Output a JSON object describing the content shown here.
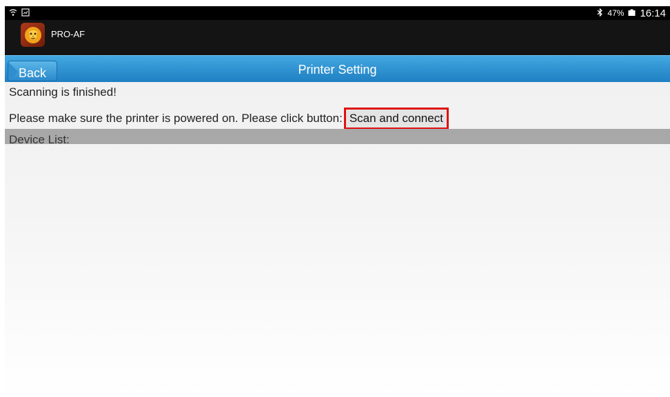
{
  "status_bar": {
    "left_icons": [
      "wifi-icon",
      "screenshot-icon"
    ],
    "bluetooth_icon": "bluetooth-icon",
    "battery_percent": "47%",
    "battery_icon": "battery-icon",
    "time": "16:14"
  },
  "app_bar": {
    "app_icon": "lion-logo-icon",
    "app_name": "PRO-AF"
  },
  "nav": {
    "back_label": "Back",
    "title": "Printer Setting"
  },
  "main": {
    "status_message": "Scanning is finished!",
    "instruction": "Please make sure the printer is powered on. Please click button:",
    "scan_button_label": "Scan and connect",
    "device_list_label": "Device List:"
  },
  "colors": {
    "nav_blue": "#2d90d2",
    "highlight_red": "#e01010",
    "list_header_gray": "#a8a8a8"
  }
}
